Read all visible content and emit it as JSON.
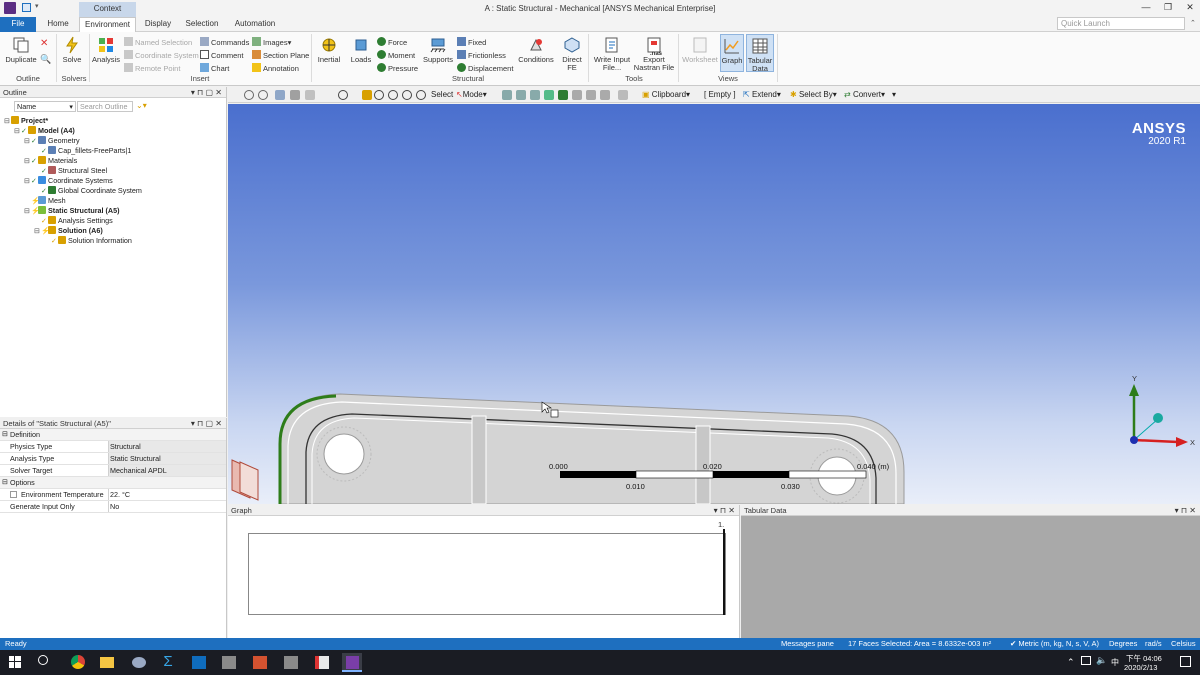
{
  "window": {
    "title": "A : Static Structural - Mechanical [ANSYS Mechanical Enterprise]",
    "context_label": "Context",
    "quick_launch_placeholder": "Quick Launch"
  },
  "tabs": [
    "File",
    "Home",
    "Environment",
    "Display",
    "Selection",
    "Automation"
  ],
  "ribbon": {
    "outline_group": {
      "duplicate": "Duplicate",
      "label": "Outline"
    },
    "solve_group": {
      "solve": "Solve",
      "label": "Solvers"
    },
    "insert_group": {
      "analysis": "Analysis",
      "named_selection": "Named Selection",
      "coordinate_system": "Coordinate System",
      "remote_point": "Remote Point",
      "commands": "Commands",
      "comment": "Comment",
      "chart": "Chart",
      "images": "Images",
      "section_plane": "Section Plane",
      "annotation": "Annotation",
      "label": "Insert"
    },
    "structural_group": {
      "inertial": "Inertial",
      "loads": "Loads",
      "force": "Force",
      "moment": "Moment",
      "pressure": "Pressure",
      "supports": "Supports",
      "fixed": "Fixed",
      "frictionless": "Frictionless",
      "displacement": "Displacement",
      "conditions": "Conditions",
      "direct_fe_1": "Direct",
      "direct_fe_2": "FE",
      "label": "Structural"
    },
    "tools_group": {
      "write_input_1": "Write Input",
      "write_input_2": "File...",
      "export_nastran_1": "Export",
      "export_nastran_2": "Nastran File",
      "nas_badge": ".nas",
      "label": "Tools"
    },
    "views_group": {
      "worksheet": "Worksheet",
      "graph": "Graph",
      "tabular_1": "Tabular",
      "tabular_2": "Data",
      "label": "Views"
    }
  },
  "outline": {
    "title": "Outline",
    "name_label": "Name",
    "search_placeholder": "Search Outline",
    "tree": [
      {
        "label": "Project*",
        "level": 0,
        "bold": true
      },
      {
        "label": "Model (A4)",
        "level": 1,
        "bold": true
      },
      {
        "label": "Geometry",
        "level": 2,
        "bold": false
      },
      {
        "label": "Cap_fillets-FreeParts|1",
        "level": 3,
        "bold": false
      },
      {
        "label": "Materials",
        "level": 2,
        "bold": false
      },
      {
        "label": "Structural Steel",
        "level": 3,
        "bold": false
      },
      {
        "label": "Coordinate Systems",
        "level": 2,
        "bold": false
      },
      {
        "label": "Global Coordinate System",
        "level": 3,
        "bold": false
      },
      {
        "label": "Mesh",
        "level": 2,
        "bold": false
      },
      {
        "label": "Static Structural (A5)",
        "level": 2,
        "bold": true
      },
      {
        "label": "Analysis Settings",
        "level": 3,
        "bold": false
      },
      {
        "label": "Solution (A6)",
        "level": 3,
        "bold": true
      },
      {
        "label": "Solution Information",
        "level": 4,
        "bold": false
      }
    ]
  },
  "details": {
    "title": "Details of \"Static Structural (A5)\"",
    "sections": [
      {
        "name": "Definition",
        "rows": [
          {
            "key": "Physics Type",
            "value": "Structural"
          },
          {
            "key": "Analysis Type",
            "value": "Static Structural"
          },
          {
            "key": "Solver Target",
            "value": "Mechanical APDL"
          }
        ]
      },
      {
        "name": "Options",
        "rows": [
          {
            "key": "Environment Temperature",
            "value": "22. °C"
          },
          {
            "key": "Generate Input Only",
            "value": "No"
          }
        ]
      }
    ]
  },
  "toolbar": {
    "select": "Select",
    "mode": "Mode",
    "clipboard": "Clipboard",
    "empty": "[ Empty ]",
    "extend": "Extend",
    "select_by": "Select By",
    "convert": "Convert"
  },
  "viewport": {
    "brand": "ANSYS",
    "version": "2020 R1",
    "scale_ticks_top": [
      "0.000",
      "0.020",
      "0.040 (m)"
    ],
    "scale_ticks_bottom": [
      "0.010",
      "0.030"
    ],
    "triad_y": "Y",
    "triad_x": "X"
  },
  "graph": {
    "title": "Graph",
    "axis_value": "1."
  },
  "tabular": {
    "title": "Tabular Data"
  },
  "status": {
    "ready": "Ready",
    "messages": "Messages pane",
    "selection": "17 Faces Selected: Area = 8.6332e-003 m²",
    "units": "Metric (m, kg, N, s, V, A)",
    "degrees": "Degrees",
    "rads": "rad/s",
    "temp": "Celsius"
  },
  "taskbar": {
    "time": "下午 04:06",
    "date": "2020/2/13",
    "ime": "中"
  },
  "colors": {
    "accent": "#1e6fbf",
    "status_bar": "#1e6fbf",
    "taskbar": "#1a1c23",
    "viewport_top": "#4a6fce",
    "viewport_bottom": "#e9eef9",
    "part_gray": "#d4d4d4",
    "edge_green": "#2e7d1a"
  }
}
